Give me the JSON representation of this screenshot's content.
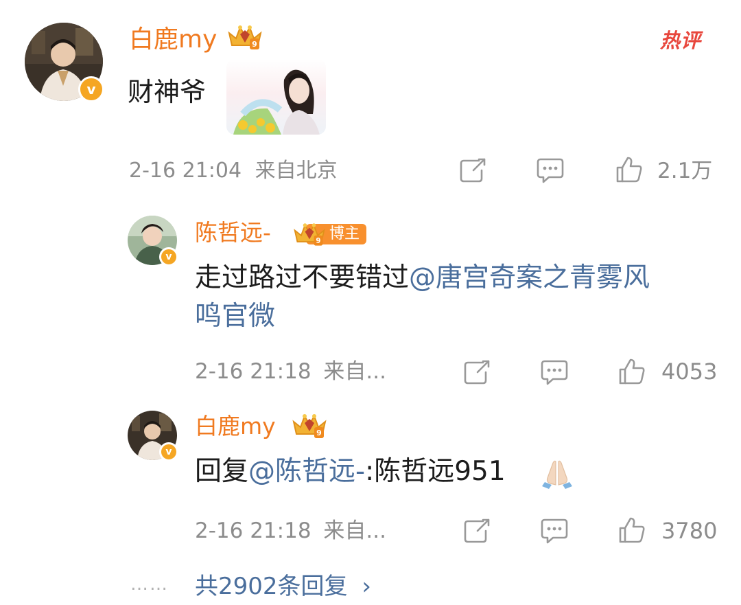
{
  "comment": {
    "username": "白鹿my",
    "badge_tag": "热评",
    "text": "财神爷",
    "time": "2-16 21:04",
    "location": "来自北京",
    "likes": "2.1万",
    "verified_mark": "v"
  },
  "replies": [
    {
      "username": "陈哲远-",
      "tag": "博主",
      "text_prefix": "走过路过不要错过",
      "mention_line1": "@唐宫奇案之青雾风",
      "mention_line2": "鸣官微",
      "time": "2-16 21:18",
      "location": "来自...",
      "likes": "4053",
      "verified_mark": "v"
    },
    {
      "username": "白鹿my",
      "text_prefix": "回复",
      "mention": "@陈哲远-",
      "text_suffix": ":陈哲远951",
      "time": "2-16 21:18",
      "location": "来自...",
      "likes": "3780",
      "verified_mark": "v"
    }
  ],
  "more_replies": {
    "dots": "……",
    "label": "共2902条回复",
    "chevron": "›"
  },
  "colors": {
    "username": "#f07a20",
    "mention": "#4a6e9c",
    "meta": "#8c8c8c",
    "hot_tag": "#e8473d",
    "verified_badge": "#f5a623"
  },
  "icons": [
    "share-icon",
    "comment-icon",
    "like-icon",
    "crown-badge-icon",
    "lightbulb-emoji-icon",
    "pray-emoji-icon",
    "chevron-right-icon"
  ]
}
